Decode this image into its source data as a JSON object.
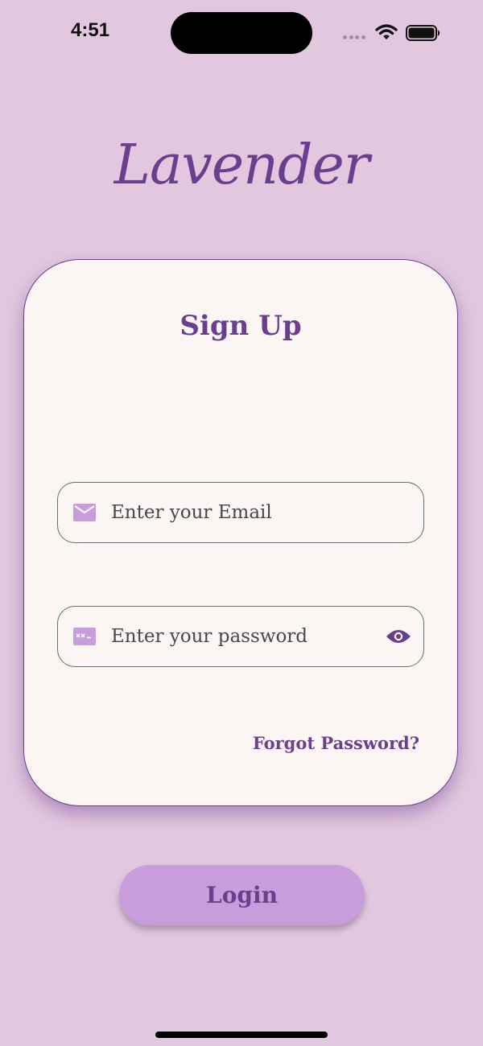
{
  "status_bar": {
    "time": "4:51"
  },
  "app": {
    "logo_text": "Lavender"
  },
  "card": {
    "title": "Sign Up",
    "email_field": {
      "placeholder": "Enter your Email",
      "value": "",
      "icon": "mail-icon"
    },
    "password_field": {
      "placeholder": "Enter your password",
      "value": "",
      "icon": "password-icon",
      "toggle_icon": "eye-icon"
    },
    "forgot_password_label": "Forgot Password?"
  },
  "login_button": {
    "label": "Login"
  },
  "colors": {
    "background": "#e2c8df",
    "card_background": "#fbf6f4",
    "accent_purple": "#6a3f8e",
    "icon_lilac": "#c79ddc",
    "button_fill": "#c79ddc",
    "field_border": "#6e6872"
  }
}
